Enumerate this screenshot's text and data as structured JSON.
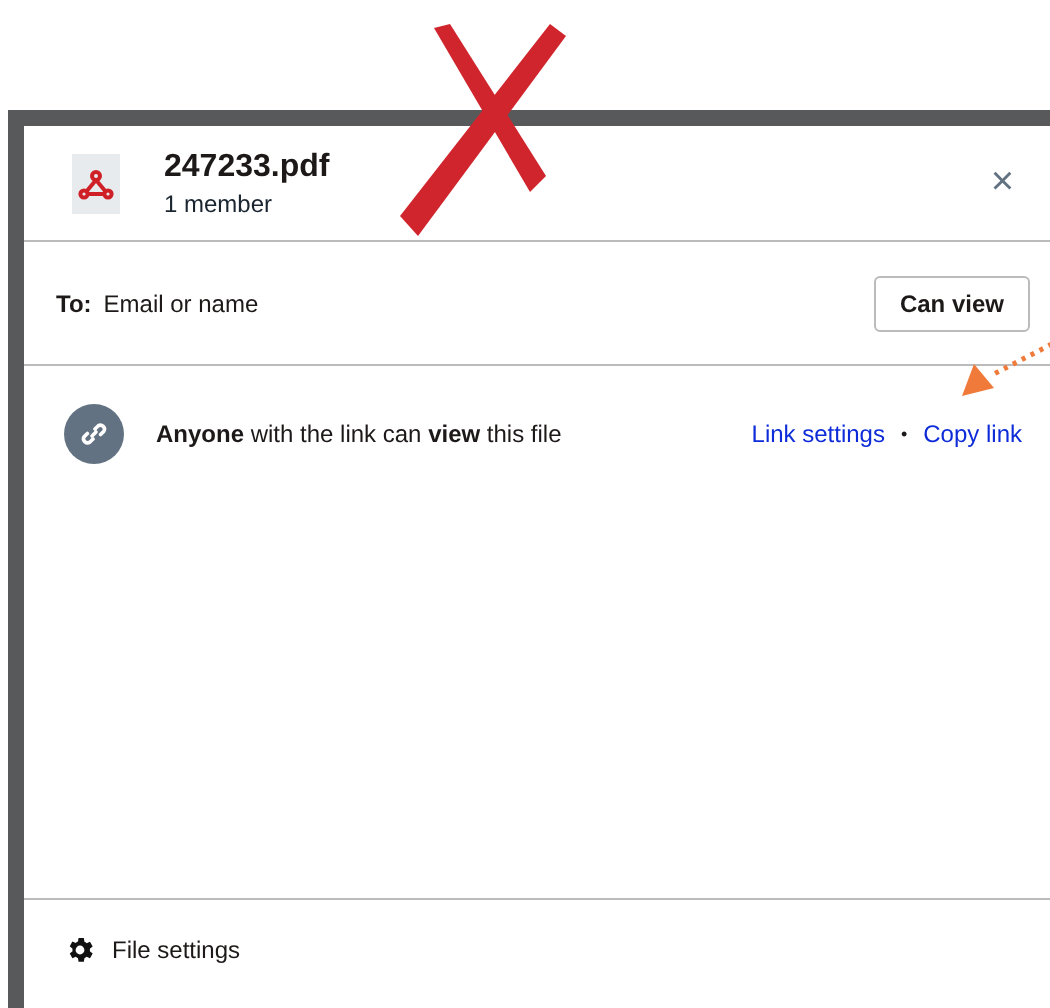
{
  "dialog": {
    "file_name": "247233.pdf",
    "subtitle": "1 member",
    "close": "×"
  },
  "invite": {
    "label": "To:",
    "placeholder": "Email or name",
    "permission_button": "Can view"
  },
  "link_access": {
    "text": "**Anyone** with the link can **view** this file",
    "links": [
      "Link settings",
      "Copy link"
    ],
    "separator": "•"
  },
  "footer": {
    "label": "File settings"
  }
}
